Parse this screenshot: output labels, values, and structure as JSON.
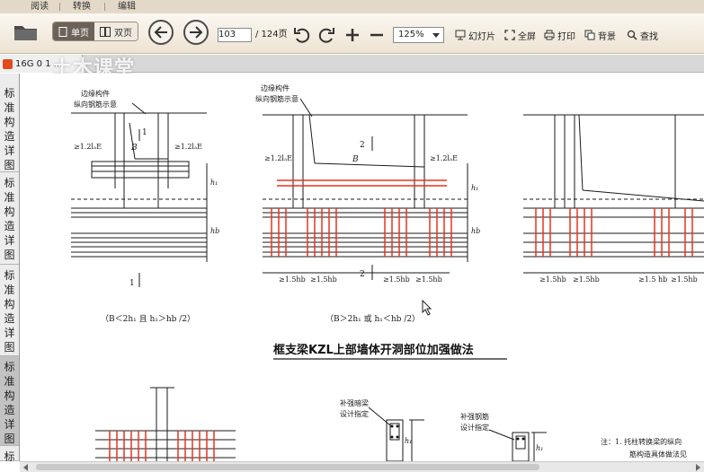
{
  "menu": {
    "tabs": [
      "阅读",
      "转换",
      "编辑"
    ]
  },
  "toolbar": {
    "single_page": "单页",
    "double_page": "双页",
    "current_page": "103",
    "total_pages": "/ 124页",
    "zoom": "125%",
    "slideshow": "幻灯片",
    "fullscreen": "全屏",
    "print": "打印",
    "background": "背景",
    "find": "查找"
  },
  "document_tab": {
    "title": "16G 0 1 ..."
  },
  "watermark": "土木课堂",
  "sidebar": {
    "items": [
      {
        "label": "标准构造详图"
      },
      {
        "label": "标准构造详图"
      },
      {
        "label": "标准构造详图"
      },
      {
        "label": "标准构造详图"
      },
      {
        "label": "标"
      }
    ]
  },
  "drawing": {
    "title": "框支梁KZL上部墙体开洞部位加强做法",
    "fig1": {
      "label_top": "边缘构件",
      "label_top2": "纵向钢筋示意",
      "num_top": "1",
      "num_bottom": "1",
      "B": "B",
      "dim_left": "≥1.2lₐE",
      "dim_right": "≥1.2lₐE",
      "h1": "h₁",
      "hb": "hb",
      "caption": "（B＜2h₁ 且 h₁＞hb /2）"
    },
    "fig2": {
      "label_top": "边缘构件",
      "label_top2": "纵向钢筋示意",
      "num_top": "2",
      "num_bottom": "2",
      "B": "B",
      "dim_left": "≥1.2lₐE",
      "dim_right": "≥1.2lₐE",
      "h1": "h₁",
      "hb": "hb",
      "dims_bottom": [
        "≥1.5hb",
        "≥1.5hb",
        "≥1.5hb",
        "≥1.5hb"
      ],
      "caption": "（B＞2h₁ 或 h₁＜hb /2）"
    },
    "fig3": {
      "dims_bottom": [
        "≥1.5hb",
        "≥1.5hb",
        "≥1.5 hb",
        "≥1.5hb"
      ]
    },
    "bottom": {
      "label_a1": "补强暗梁",
      "label_a2": "设计指定",
      "label_b1": "补强钢筋",
      "label_b2": "设计指定",
      "h1": "h₁",
      "note1": "注：1. 托柱转换梁的纵向",
      "note2": "筋构造具体做法见"
    }
  },
  "colors": {
    "rebar_red": "#e8321e",
    "toolbar_bg": "#efe6d6",
    "line": "#1a1a1a"
  }
}
